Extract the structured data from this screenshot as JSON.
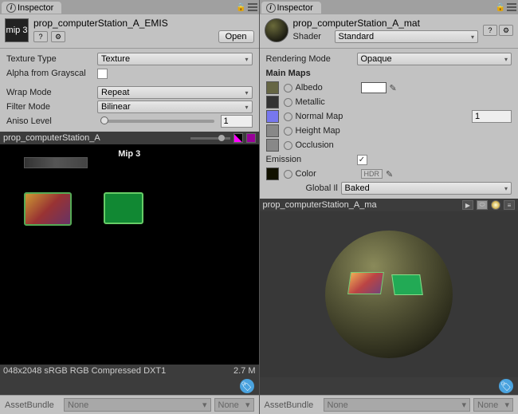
{
  "left": {
    "tab": "Inspector",
    "asset_name": "prop_computerStation_A_EMIS",
    "mip_badge": "mip 3",
    "open_btn": "Open",
    "props": {
      "texture_type_label": "Texture Type",
      "texture_type_value": "Texture",
      "alpha_label": "Alpha from Grayscal",
      "wrap_label": "Wrap Mode",
      "wrap_value": "Repeat",
      "filter_label": "Filter Mode",
      "filter_value": "Bilinear",
      "aniso_label": "Aniso Level",
      "aniso_value": "1"
    },
    "preview_title": "prop_computerStation_A",
    "mip_label": "Mip 3",
    "tex_info_left": "048x2048 sRGB  RGB Compressed DXT1",
    "tex_info_right": "2.7 M",
    "bundle_label": "AssetBundle",
    "bundle_value": "None",
    "bundle_suffix": "None"
  },
  "right": {
    "tab": "Inspector",
    "asset_name": "prop_computerStation_A_mat",
    "shader_label": "Shader",
    "shader_value": "Standard",
    "rendering_mode_label": "Rendering Mode",
    "rendering_mode_value": "Opaque",
    "main_maps_label": "Main Maps",
    "albedo_label": "Albedo",
    "metallic_label": "Metallic",
    "normal_label": "Normal Map",
    "normal_value": "1",
    "height_label": "Height Map",
    "occlusion_label": "Occlusion",
    "emission_label": "Emission",
    "emission_checked": true,
    "color_label": "Color",
    "hdr": "HDR",
    "gi_label": "Global Illumi",
    "gi_value": "Baked",
    "preview_title": "prop_computerStation_A_ma",
    "bundle_label": "AssetBundle",
    "bundle_value": "None",
    "bundle_suffix": "None"
  }
}
